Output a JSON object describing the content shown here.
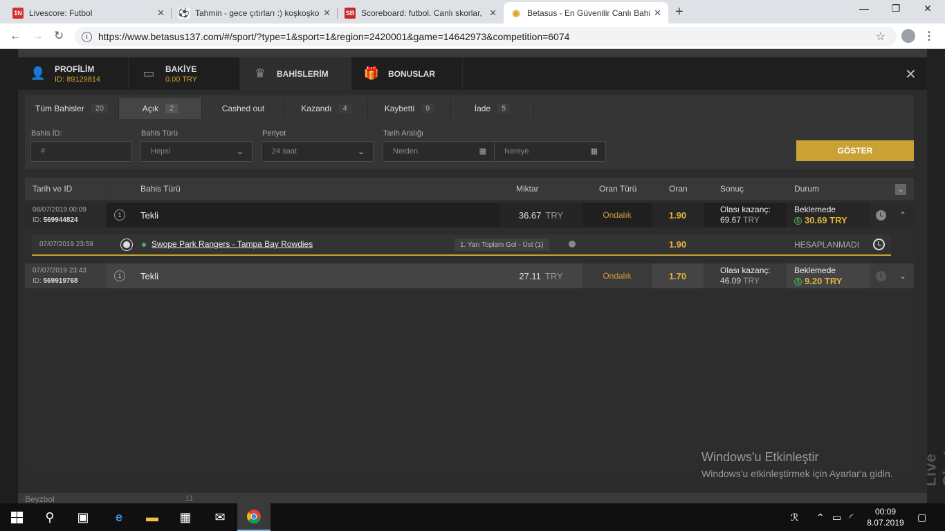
{
  "browser": {
    "tabs": [
      {
        "label": "Livescore: Futbol",
        "favicon_text": "1N",
        "favicon_color": "#d32f2f",
        "active": false
      },
      {
        "label": "Tahmin - gece çıtırları :) koşkoşko",
        "favicon_text": "⚽",
        "favicon_color": "#444444",
        "active": false
      },
      {
        "label": "Scoreboard: futbol. Canlı skorlar,",
        "favicon_text": "SB",
        "favicon_color": "#c62828",
        "active": false
      },
      {
        "label": "Betasus - En Güvenilir Canlı Bahis",
        "favicon_text": "◉",
        "favicon_color": "#e0a020",
        "active": true
      }
    ],
    "new_tab": "+",
    "url": "https://www.betasus137.com/#/sport/?type=1&sport=1&region=2420001&game=14642973&competition=6074",
    "window_controls": {
      "minimize": "—",
      "maximize": "❐",
      "close": "✕"
    }
  },
  "modal": {
    "tabs": [
      {
        "title": "PROFİLİM",
        "subtitle": "ID: 89129814",
        "icon": "user-icon",
        "glyph": "👤"
      },
      {
        "title": "BAKİYE",
        "subtitle": "0.00 TRY",
        "icon": "wallet-icon",
        "glyph": "▭"
      },
      {
        "title": "BAHİSLERİM",
        "subtitle": "",
        "icon": "trophy-icon",
        "glyph": "♛"
      },
      {
        "title": "BONUSLAR",
        "subtitle": "",
        "icon": "gift-icon",
        "glyph": "🎁"
      }
    ],
    "close": "✕",
    "filter_tabs": [
      {
        "label": "Tüm Bahisler",
        "count": "20"
      },
      {
        "label": "Açık",
        "count": "2"
      },
      {
        "label": "Cashed out",
        "count": ""
      },
      {
        "label": "Kazandı",
        "count": "4"
      },
      {
        "label": "Kaybetti",
        "count": "9"
      },
      {
        "label": "İade",
        "count": "5"
      }
    ],
    "filters": {
      "bet_id_label": "Bahis İD:",
      "bet_id_placeholder": "#",
      "bet_type_label": "Bahis Türü",
      "bet_type_value": "Hepsi",
      "period_label": "Periyot",
      "period_value": "24 saat",
      "date_range_label": "Tarih Aralığı",
      "from_placeholder": "Nerden",
      "to_placeholder": "Nereye",
      "show_button": "GÖSTER"
    },
    "table": {
      "headers": {
        "date_id": "Tarih ve ID",
        "bet_type": "Bahis Türü",
        "amount": "Miktar",
        "odds_type": "Oran Türü",
        "odds": "Oran",
        "result": "Sonuç",
        "status": "Durum"
      },
      "bets": [
        {
          "date": "08/07/2019 00:09",
          "id_label": "ID:",
          "id": "569944824",
          "index": "1",
          "type": "Tekli",
          "amount": "36.67",
          "currency": "TRY",
          "odds_type": "Ondalık",
          "odds": "1.90",
          "result_label": "Olası kazanç:",
          "result_amount": "69.67",
          "result_currency": "TRY",
          "status": "Beklemede",
          "cashout": "30.69 TRY",
          "expander": "⌃"
        },
        {
          "date": "07/07/2019 23:43",
          "id_label": "ID:",
          "id": "569919768",
          "index": "1",
          "type": "Tekli",
          "amount": "27.11",
          "currency": "TRY",
          "odds_type": "Ondalık",
          "odds": "1.70",
          "result_label": "Olası kazanç:",
          "result_amount": "46.09",
          "result_currency": "TRY",
          "status": "Beklemede",
          "cashout": "9.20 TRY",
          "expander": "⌄"
        }
      ],
      "event": {
        "date": "07/07/2019 23:59",
        "name": "Swope Park Rangers - Tampa Bay Rowdies",
        "market": "1. Yarı Toplam Gol - Üst (1)",
        "odds": "1.90",
        "status": "HESAPLANMADI"
      }
    }
  },
  "background": {
    "livechat": "Live Chat",
    "sport_item": "Beyzbol",
    "sport_count": "11"
  },
  "watermark": {
    "title": "Windows'u Etkinleştir",
    "subtitle": "Windows'u etkinleştirmek için Ayarlar'a gidin."
  },
  "taskbar": {
    "time": "00:09",
    "date": "8.07.2019"
  }
}
